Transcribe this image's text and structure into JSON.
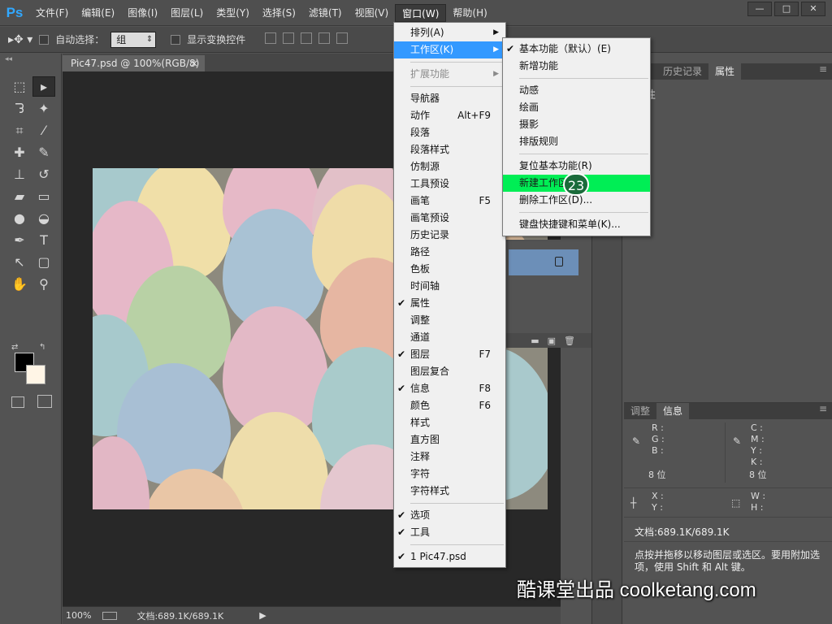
{
  "app": {
    "logo": "Ps"
  },
  "menubar": {
    "items": [
      "文件(F)",
      "编辑(E)",
      "图像(I)",
      "图层(L)",
      "类型(Y)",
      "选择(S)",
      "滤镜(T)",
      "视图(V)",
      "窗口(W)",
      "帮助(H)"
    ],
    "active_index": 8
  },
  "window_buttons": {
    "minimize": "—",
    "maximize": "□",
    "close": "✕"
  },
  "options_bar": {
    "auto_select_label": "自动选择：",
    "auto_select_value": "组",
    "show_transform_label": "显示变换控件"
  },
  "document": {
    "tab_title": "Pic47.psd @ 100%(RGB/8)",
    "tab_close": "×",
    "zoom": "100%",
    "doc_info": "文档:689.1K/689.1K"
  },
  "panels": {
    "top_tabs": [
      "路径",
      "历史记录",
      "属性"
    ],
    "active_tab": "属性",
    "properties_title": "性",
    "bottom_tabs": [
      "调整",
      "信息"
    ],
    "info": {
      "left_rgb": [
        "R :",
        "G :",
        "B :"
      ],
      "right_cmyk": [
        "C :",
        "M :",
        "Y :",
        "K :"
      ],
      "bit_left": "8 位",
      "bit_right": "8 位",
      "xy": [
        "X :",
        "Y :"
      ],
      "wh": [
        "W :",
        "H :"
      ],
      "doc": "文档:689.1K/689.1K",
      "hint": "点按并拖移以移动图层或选区。要用附加选项，使用 Shift 和 Alt 键。"
    }
  },
  "window_menu": {
    "items": [
      {
        "label": "排列(A)",
        "submenu": true
      },
      {
        "label": "工作区(K)",
        "submenu": true,
        "highlight": true
      },
      {
        "sep": true
      },
      {
        "label": "扩展功能",
        "submenu": true,
        "disabled": true
      },
      {
        "sep": true
      },
      {
        "label": "导航器"
      },
      {
        "label": "动作",
        "shortcut": "Alt+F9"
      },
      {
        "label": "段落"
      },
      {
        "label": "段落样式"
      },
      {
        "label": "仿制源"
      },
      {
        "label": "工具预设"
      },
      {
        "label": "画笔",
        "shortcut": "F5"
      },
      {
        "label": "画笔预设"
      },
      {
        "label": "历史记录"
      },
      {
        "label": "路径"
      },
      {
        "label": "色板"
      },
      {
        "label": "时间轴"
      },
      {
        "label": "属性",
        "checked": true
      },
      {
        "label": "调整"
      },
      {
        "label": "通道"
      },
      {
        "label": "图层",
        "shortcut": "F7",
        "checked": true
      },
      {
        "label": "图层复合"
      },
      {
        "label": "信息",
        "shortcut": "F8",
        "checked": true
      },
      {
        "label": "颜色",
        "shortcut": "F6"
      },
      {
        "label": "样式"
      },
      {
        "label": "直方图"
      },
      {
        "label": "注释"
      },
      {
        "label": "字符"
      },
      {
        "label": "字符样式"
      },
      {
        "sep": true
      },
      {
        "label": "选项",
        "checked": true
      },
      {
        "label": "工具",
        "checked": true
      },
      {
        "sep": true
      },
      {
        "label": "1 Pic47.psd",
        "checked": true
      }
    ]
  },
  "workspace_menu": {
    "items": [
      {
        "label": "基本功能（默认）(E)",
        "checked": true
      },
      {
        "label": "新增功能"
      },
      {
        "sep": true
      },
      {
        "label": "动感"
      },
      {
        "label": "绘画"
      },
      {
        "label": "摄影"
      },
      {
        "label": "排版规则"
      },
      {
        "sep": true
      },
      {
        "label": "复位基本功能(R)"
      },
      {
        "label": "新建工作区",
        "green": true
      },
      {
        "label": "删除工作区(D)..."
      },
      {
        "sep": true
      },
      {
        "label": "键盘快捷键和菜单(K)..."
      }
    ]
  },
  "step_badge": "23",
  "watermark": "酷课堂出品 coolketang.com"
}
